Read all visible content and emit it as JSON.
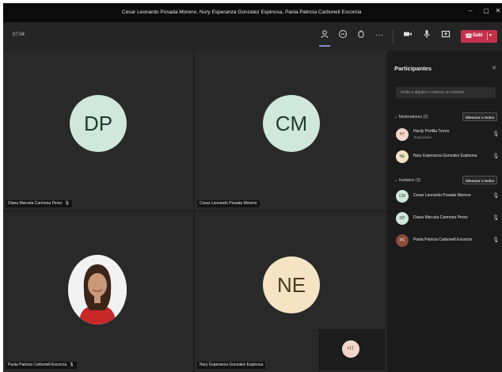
{
  "window": {
    "title": "Cesar Leonardo Posada Moreno, Nury Esperanza Gonzalez Espinosa, Paola Patricia Carbonell Escorcia",
    "minimize_icon": "minimize-icon",
    "maximize_icon": "maximize-icon",
    "close_icon": "close-icon"
  },
  "toolbar": {
    "timer": "07:04",
    "buttons": [
      "people-icon",
      "chat-icon",
      "raise-hand-icon",
      "more-icon",
      "camera-icon",
      "mic-icon",
      "share-icon"
    ],
    "leave_label": "Salir",
    "leave_color": "#c4314b"
  },
  "tiles": [
    {
      "initials": "DP",
      "name": "Diana Marcela Carmona Perez",
      "avatar_color": "#cfe7dc"
    },
    {
      "initials": "CM",
      "name": "Cesar Leonardo Posada Moreno",
      "avatar_color": "#cfe7dc"
    },
    {
      "name": "Paola Patricia Carbonell Escorcia"
    },
    {
      "initials": "NE",
      "name": "Nury Esperanza Gonzalez Espinosa",
      "avatar_color": "#f4e4c4"
    }
  ],
  "self_view": {
    "initials": "HT"
  },
  "panel": {
    "title": "Participantes",
    "invite_placeholder": "Invite a alguien o marcar un número",
    "presenters": {
      "heading": "Moderadores (2)",
      "mute_all": "Silenciar a todos",
      "people": [
        {
          "initials": "HT",
          "name": "Hardy Portilla Torres",
          "role": "Organizador",
          "avatar_color": "#f3d6c9"
        },
        {
          "initials": "NE",
          "name": "Nury Esperanza Gonzalez Espinosa",
          "avatar_color": "#f4e4c4"
        }
      ]
    },
    "attendees": {
      "heading": "Invitados (3)",
      "mute_all": "Silenciar a todos",
      "people": [
        {
          "initials": "CM",
          "name": "Cesar Leonardo Posada Moreno",
          "avatar_color": "#cfe7dc"
        },
        {
          "initials": "DP",
          "name": "Diana Marcela Carmona Perez",
          "avatar_color": "#cfe7dc"
        },
        {
          "initials": "PC",
          "name": "Paola Patricia Carbonell Escorcia",
          "avatar_color": "#8a4b3a"
        }
      ]
    }
  }
}
